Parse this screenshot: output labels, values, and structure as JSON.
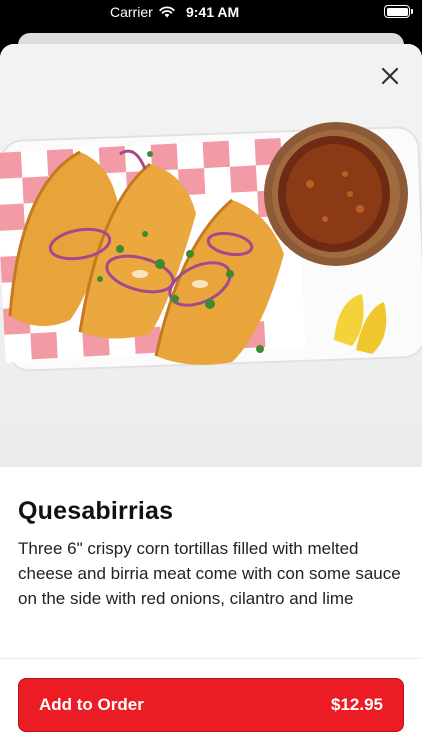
{
  "status_bar": {
    "carrier": "Carrier",
    "time": "9:41 AM"
  },
  "item": {
    "title": "Quesabirrias",
    "description": "Three 6\" crispy corn tortillas filled with melted cheese and birria meat come with con some sauce on the side with red onions, cilantro and lime"
  },
  "order_button": {
    "label": "Add to Order",
    "price": "$12.95"
  },
  "colors": {
    "accent": "#ec1c24"
  },
  "icons": {
    "close": "close-icon",
    "wifi": "wifi-icon",
    "battery": "battery-icon"
  }
}
